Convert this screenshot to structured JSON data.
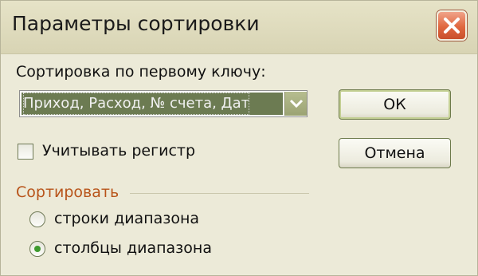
{
  "window": {
    "title": "Параметры сортировки",
    "close_icon": "close-icon"
  },
  "sort_key": {
    "label": "Сортировка по первому ключу:",
    "value": "Приход, Расход, № счета, Дат",
    "dropdown_icon": "chevron-down-icon"
  },
  "case_sensitive": {
    "label": "Учитывать регистр",
    "checked": false
  },
  "buttons": {
    "ok_label": "ОК",
    "cancel_label": "Отмена"
  },
  "orientation": {
    "group_label": "Сортировать",
    "options": [
      {
        "label": "строки диапазона",
        "selected": false
      },
      {
        "label": "столбцы диапазона",
        "selected": true
      }
    ]
  },
  "colors": {
    "dialog_bg": "#ecead8",
    "close_button": "#e0673f",
    "selection": "#6c7b52",
    "group_label": "#b8541a",
    "radio_dot": "#3e9a2e"
  }
}
